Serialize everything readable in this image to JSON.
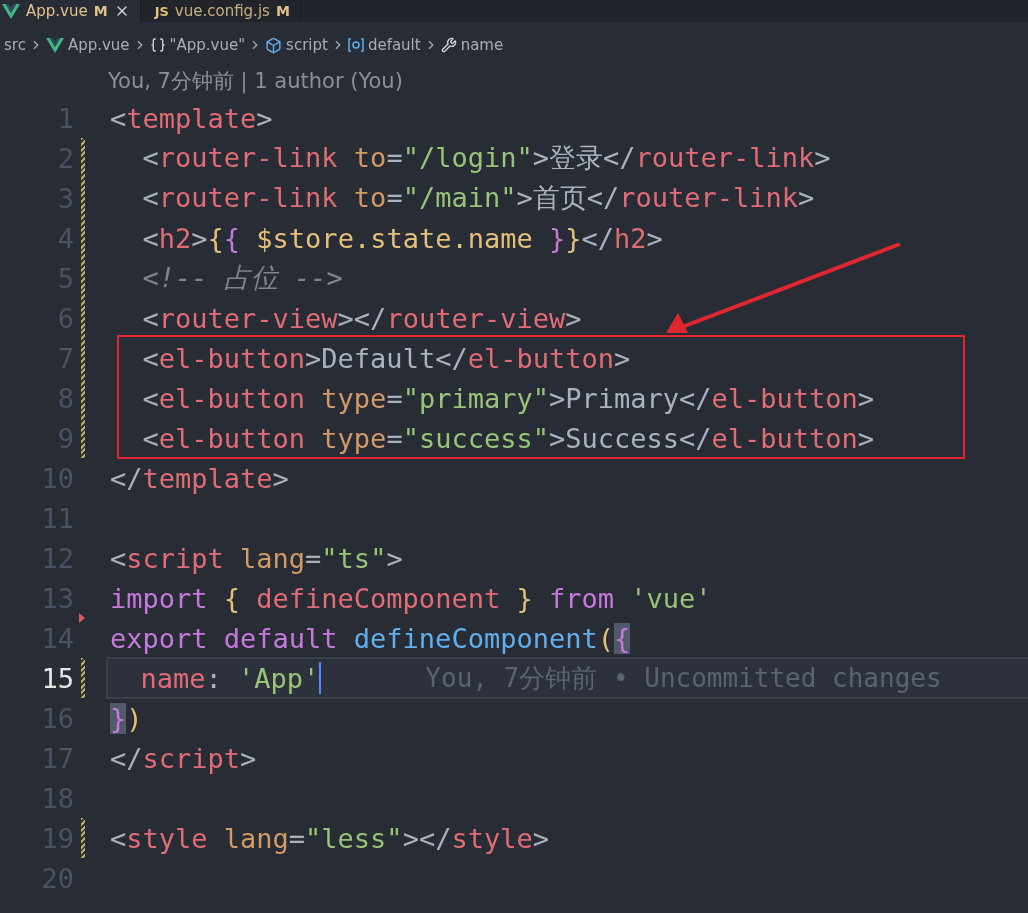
{
  "tabs": [
    {
      "label": "App.vue",
      "kind": "vue",
      "status": "M",
      "selected": true,
      "closable": true
    },
    {
      "label": "vue.config.js",
      "kind": "js",
      "icon_text": "JS",
      "status": "M",
      "selected": false,
      "closable": false
    }
  ],
  "breadcrumb": [
    {
      "label": "src",
      "kind": "folder"
    },
    {
      "label": "App.vue",
      "kind": "vue"
    },
    {
      "label": "\"App.vue\"",
      "kind": "braces"
    },
    {
      "label": "script",
      "kind": "module"
    },
    {
      "label": "default",
      "kind": "variable"
    },
    {
      "label": "name",
      "kind": "property"
    }
  ],
  "blame_header": "You, 7分钟前 | 1 author (You)",
  "lines": [
    {
      "number": "1",
      "modified": false,
      "deleted": false,
      "current": false,
      "boxed": false,
      "tokens": [
        {
          "t": "<",
          "kind": "punct"
        },
        {
          "t": "template",
          "kind": "tag"
        },
        {
          "t": ">",
          "kind": "punct"
        }
      ]
    },
    {
      "number": "2",
      "modified": true,
      "deleted": false,
      "current": false,
      "boxed": false,
      "tokens": [
        {
          "t": "  <",
          "kind": "punct"
        },
        {
          "t": "router-link",
          "kind": "tag"
        },
        {
          "t": " to",
          "kind": "attr"
        },
        {
          "t": "=",
          "kind": "punct"
        },
        {
          "t": "\"/login\"",
          "kind": "string"
        },
        {
          "t": ">登录</",
          "kind": "punct"
        },
        {
          "t": "router-link",
          "kind": "tag"
        },
        {
          "t": ">",
          "kind": "punct"
        }
      ]
    },
    {
      "number": "3",
      "modified": true,
      "deleted": false,
      "current": false,
      "boxed": false,
      "tokens": [
        {
          "t": "  <",
          "kind": "punct"
        },
        {
          "t": "router-link",
          "kind": "tag"
        },
        {
          "t": " to",
          "kind": "attr"
        },
        {
          "t": "=",
          "kind": "punct"
        },
        {
          "t": "\"/main\"",
          "kind": "string"
        },
        {
          "t": ">首页</",
          "kind": "punct"
        },
        {
          "t": "router-link",
          "kind": "tag"
        },
        {
          "t": ">",
          "kind": "punct"
        }
      ]
    },
    {
      "number": "4",
      "modified": true,
      "deleted": false,
      "current": false,
      "boxed": false,
      "tokens": [
        {
          "t": "  <",
          "kind": "punct"
        },
        {
          "t": "h2",
          "kind": "tag"
        },
        {
          "t": ">",
          "kind": "punct"
        },
        {
          "t": "{",
          "kind": "brace"
        },
        {
          "t": "{",
          "kind": "brace2"
        },
        {
          "t": " $store.state.name ",
          "kind": "variable"
        },
        {
          "t": "}",
          "kind": "brace2"
        },
        {
          "t": "}",
          "kind": "brace"
        },
        {
          "t": "</",
          "kind": "punct"
        },
        {
          "t": "h2",
          "kind": "tag"
        },
        {
          "t": ">",
          "kind": "punct"
        }
      ]
    },
    {
      "number": "5",
      "modified": true,
      "deleted": false,
      "current": false,
      "boxed": false,
      "tokens": [
        {
          "t": "  <!-- 占位 -->",
          "kind": "comment"
        }
      ]
    },
    {
      "number": "6",
      "modified": true,
      "deleted": false,
      "current": false,
      "boxed": false,
      "tokens": [
        {
          "t": "  <",
          "kind": "punct"
        },
        {
          "t": "router-view",
          "kind": "tag"
        },
        {
          "t": "></",
          "kind": "punct"
        },
        {
          "t": "router-view",
          "kind": "tag"
        },
        {
          "t": ">",
          "kind": "punct"
        }
      ]
    },
    {
      "number": "7",
      "modified": true,
      "deleted": false,
      "current": false,
      "boxed": true,
      "tokens": [
        {
          "t": "  <",
          "kind": "punct"
        },
        {
          "t": "el-button",
          "kind": "tag"
        },
        {
          "t": ">Default</",
          "kind": "punct"
        },
        {
          "t": "el-button",
          "kind": "tag"
        },
        {
          "t": ">",
          "kind": "punct"
        }
      ]
    },
    {
      "number": "8",
      "modified": true,
      "deleted": false,
      "current": false,
      "boxed": true,
      "tokens": [
        {
          "t": "  <",
          "kind": "punct"
        },
        {
          "t": "el-button",
          "kind": "tag"
        },
        {
          "t": " type",
          "kind": "attr"
        },
        {
          "t": "=",
          "kind": "punct"
        },
        {
          "t": "\"primary\"",
          "kind": "string"
        },
        {
          "t": ">Primary</",
          "kind": "punct"
        },
        {
          "t": "el-button",
          "kind": "tag"
        },
        {
          "t": ">",
          "kind": "punct"
        }
      ]
    },
    {
      "number": "9",
      "modified": true,
      "deleted": false,
      "current": false,
      "boxed": true,
      "tokens": [
        {
          "t": "  <",
          "kind": "punct"
        },
        {
          "t": "el-button",
          "kind": "tag"
        },
        {
          "t": " type",
          "kind": "attr"
        },
        {
          "t": "=",
          "kind": "punct"
        },
        {
          "t": "\"success\"",
          "kind": "string"
        },
        {
          "t": ">Success</",
          "kind": "punct"
        },
        {
          "t": "el-button",
          "kind": "tag"
        },
        {
          "t": ">",
          "kind": "punct"
        }
      ]
    },
    {
      "number": "10",
      "modified": false,
      "deleted": false,
      "current": false,
      "boxed": false,
      "tokens": [
        {
          "t": "</",
          "kind": "punct"
        },
        {
          "t": "template",
          "kind": "tag"
        },
        {
          "t": ">",
          "kind": "punct"
        }
      ]
    },
    {
      "number": "11",
      "modified": false,
      "deleted": false,
      "current": false,
      "boxed": false
    },
    {
      "number": "12",
      "modified": false,
      "deleted": false,
      "current": false,
      "boxed": false,
      "tokens": [
        {
          "t": "<",
          "kind": "punct"
        },
        {
          "t": "script",
          "kind": "tag"
        },
        {
          "t": " lang",
          "kind": "attr"
        },
        {
          "t": "=",
          "kind": "punct"
        },
        {
          "t": "\"ts\"",
          "kind": "string"
        },
        {
          "t": ">",
          "kind": "punct"
        }
      ]
    },
    {
      "number": "13",
      "modified": false,
      "deleted": true,
      "current": false,
      "boxed": false,
      "tokens": [
        {
          "t": "import ",
          "kind": "keyword"
        },
        {
          "t": "{",
          "kind": "brace"
        },
        {
          "t": " defineComponent ",
          "kind": "tag"
        },
        {
          "t": "}",
          "kind": "brace"
        },
        {
          "t": " from ",
          "kind": "keyword"
        },
        {
          "t": "'vue'",
          "kind": "string"
        }
      ]
    },
    {
      "number": "14",
      "modified": false,
      "deleted": false,
      "current": false,
      "boxed": false,
      "tokens": [
        {
          "t": "export default ",
          "kind": "keyword"
        },
        {
          "t": "defineComponent",
          "kind": "func"
        },
        {
          "t": "(",
          "kind": "brace"
        },
        {
          "t": "{",
          "kind": "brace2",
          "matched": true
        }
      ]
    },
    {
      "number": "15",
      "modified": true,
      "deleted": false,
      "current": true,
      "boxed": false,
      "blame": "You, 7分钟前 • Uncommitted changes",
      "tokens": [
        {
          "t": "  name",
          "kind": "tag"
        },
        {
          "t": ": ",
          "kind": "punct"
        },
        {
          "t": "'App'",
          "kind": "string"
        }
      ]
    },
    {
      "number": "16",
      "modified": false,
      "deleted": false,
      "current": false,
      "boxed": false,
      "tokens": [
        {
          "t": "}",
          "kind": "brace2",
          "matched": true
        },
        {
          "t": ")",
          "kind": "brace"
        }
      ]
    },
    {
      "number": "17",
      "modified": false,
      "deleted": false,
      "current": false,
      "boxed": false,
      "tokens": [
        {
          "t": "</",
          "kind": "punct"
        },
        {
          "t": "script",
          "kind": "tag"
        },
        {
          "t": ">",
          "kind": "punct"
        }
      ]
    },
    {
      "number": "18",
      "modified": false,
      "deleted": false,
      "current": false,
      "boxed": false
    },
    {
      "number": "19",
      "modified": true,
      "deleted": false,
      "current": false,
      "boxed": false,
      "tokens": [
        {
          "t": "<",
          "kind": "punct"
        },
        {
          "t": "style",
          "kind": "tag"
        },
        {
          "t": " lang",
          "kind": "attr"
        },
        {
          "t": "=",
          "kind": "punct"
        },
        {
          "t": "\"less\"",
          "kind": "string"
        },
        {
          "t": "></",
          "kind": "punct"
        },
        {
          "t": "style",
          "kind": "tag"
        },
        {
          "t": ">",
          "kind": "punct"
        }
      ]
    },
    {
      "number": "20",
      "modified": false,
      "deleted": false,
      "current": false,
      "boxed": false
    }
  ]
}
